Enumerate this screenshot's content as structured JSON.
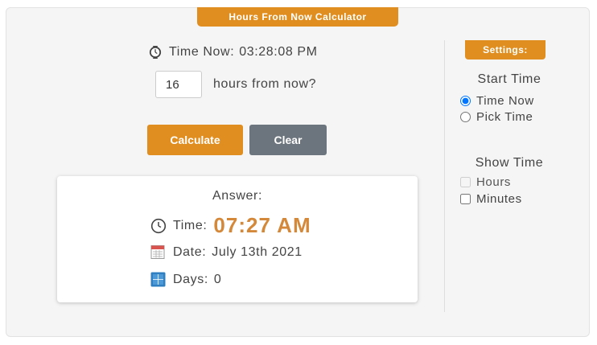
{
  "header": {
    "title": "Hours From Now Calculator"
  },
  "time_now": {
    "label": "Time Now:",
    "value": "03:28:08 PM"
  },
  "hours_input": {
    "value": "16",
    "label": "hours from now?"
  },
  "buttons": {
    "calculate": "Calculate",
    "clear": "Clear"
  },
  "answer": {
    "title": "Answer:",
    "time_label": "Time:",
    "time_value": "07:27 AM",
    "date_label": "Date:",
    "date_value": "July 13th 2021",
    "days_label": "Days:",
    "days_value": "0"
  },
  "settings": {
    "tab_label": "Settings:",
    "start_time": {
      "title": "Start Time",
      "options": [
        "Time Now",
        "Pick Time"
      ],
      "selected": "Time Now"
    },
    "show_time": {
      "title": "Show Time",
      "options": [
        {
          "label": "Hours",
          "checked": false,
          "disabled": true
        },
        {
          "label": "Minutes",
          "checked": false,
          "disabled": false
        }
      ]
    }
  },
  "colors": {
    "accent": "#e08e1f",
    "clear_button": "#6c757d",
    "result": "#d4893a"
  },
  "icons": {
    "time_now": "stopwatch-icon",
    "answer_time": "clock-icon",
    "answer_date": "calendar-icon",
    "answer_days": "days-calendar-icon"
  }
}
